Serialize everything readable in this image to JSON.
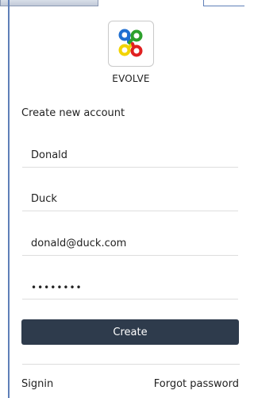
{
  "app": {
    "brand_name": "EVOLVE",
    "logo_icon": "evolve-logo-icon",
    "logo_colors": [
      "#1f6fd1",
      "#2ca02c",
      "#f2d400",
      "#e02020"
    ]
  },
  "form": {
    "heading": "Create new account",
    "first_name_value": "Donald",
    "last_name_value": "Duck",
    "email_value": "donald@duck.com",
    "password_value": "12345678",
    "create_label": "Create"
  },
  "footer": {
    "signin_label": "Signin",
    "forgot_label": "Forgot password"
  },
  "colors": {
    "button_bg": "#2e3b4c",
    "accent_rule": "#5f7fb8"
  }
}
